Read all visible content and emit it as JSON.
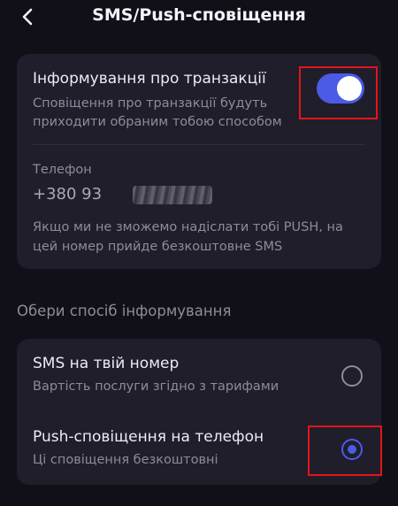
{
  "header": {
    "title": "SMS/Push-сповіщення",
    "back_icon": "chevron-left-icon"
  },
  "transactions": {
    "title": "Інформування про транзакції",
    "subtitle_line1": "Сповіщення про транзакції будуть",
    "subtitle_line2": "приходити обраним тобою способом",
    "toggle_on": true,
    "accent": "#4b5be6"
  },
  "phone": {
    "label": "Телефон",
    "visible_part": "+380 93",
    "note_line1": "Якщо ми не зможемо надіслати тобі PUSH, на",
    "note_line2": "цей номер прийде безкоштовне SMS"
  },
  "method": {
    "section_title": "Обери спосіб інформування",
    "options": [
      {
        "title": "SMS на твій номер",
        "subtitle": "Вартість послуги згідно з тарифами",
        "selected": false
      },
      {
        "title": "Push-сповіщення на телефон",
        "subtitle": "Ці сповіщення безкоштовні",
        "selected": true
      }
    ]
  },
  "highlight_color": "#e4141b"
}
